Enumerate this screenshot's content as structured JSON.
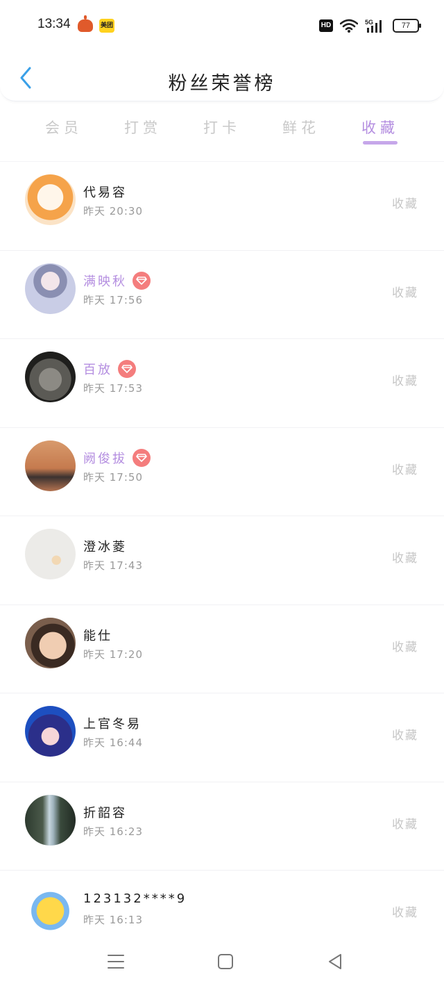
{
  "status_bar": {
    "time": "13:34",
    "app_badge": "美团",
    "hd": "HD",
    "network": "5G",
    "battery": "77"
  },
  "header": {
    "title": "粉丝荣誉榜",
    "back_icon": "chevron-left-icon"
  },
  "tabs": [
    {
      "label": "会员",
      "active": false
    },
    {
      "label": "打赏",
      "active": false
    },
    {
      "label": "打卡",
      "active": false
    },
    {
      "label": "鲜花",
      "active": false
    },
    {
      "label": "收藏",
      "active": true
    }
  ],
  "colors": {
    "accent": "#b48ee0",
    "badge": "#f47d7d",
    "back": "#3aa0e8",
    "muted": "#c6c6c6"
  },
  "fans": [
    {
      "name": "代易容",
      "time": "昨天 20:30",
      "action": "收藏",
      "vip": false
    },
    {
      "name": "满映秋",
      "time": "昨天 17:56",
      "action": "收藏",
      "vip": true
    },
    {
      "name": "百放",
      "time": "昨天 17:53",
      "action": "收藏",
      "vip": true
    },
    {
      "name": "阙俊拔",
      "time": "昨天 17:50",
      "action": "收藏",
      "vip": true
    },
    {
      "name": "澄冰菱",
      "time": "昨天 17:43",
      "action": "收藏",
      "vip": false
    },
    {
      "name": "能仕",
      "time": "昨天 17:20",
      "action": "收藏",
      "vip": false
    },
    {
      "name": "上官冬易",
      "time": "昨天 16:44",
      "action": "收藏",
      "vip": false
    },
    {
      "name": "折韶容",
      "time": "昨天 16:23",
      "action": "收藏",
      "vip": false
    },
    {
      "name": "123132****9",
      "time": "昨天 16:13",
      "action": "收藏",
      "vip": false
    }
  ],
  "nav": {
    "menu_icon": "menu-icon",
    "home_icon": "home-square-icon",
    "back_icon": "back-triangle-icon"
  }
}
